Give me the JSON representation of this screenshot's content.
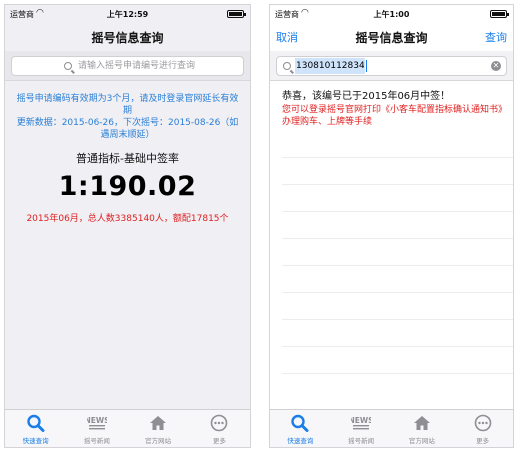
{
  "status_left": {
    "carrier": "运营商",
    "time": "上午12:59"
  },
  "status_right": {
    "carrier": "运营商",
    "time": "上午1:00"
  },
  "left_screen": {
    "title": "摇号信息查询",
    "search_placeholder": "请输入摇号申请编号进行查询",
    "info_line1": "摇号申请编码有效期为3个月，请及时登录官网延长有效期",
    "info_line2": "更新数据：2015-06-26，下次摇号：2015-08-26（如遇周末顺延）",
    "rate_label": "普通指标-基础中签率",
    "rate_value": "1:190.02",
    "rate_note": "2015年06月，总人数3385140人，额配17815个"
  },
  "right_screen": {
    "title": "摇号信息查询",
    "cancel_label": "取消",
    "query_label": "查询",
    "search_value": "1308101128349",
    "result_head": "恭喜，该编号已于2015年06月中签！",
    "result_sub": "您可以登录摇号官网打印《小客车配置指标确认通知书》办理购车、上牌等手续"
  },
  "tabs": [
    {
      "label": "快速查询",
      "icon": "search-icon",
      "active": true
    },
    {
      "label": "摇号新闻",
      "icon": "news-icon",
      "active": false
    },
    {
      "label": "官方网站",
      "icon": "home-icon",
      "active": false
    },
    {
      "label": "更多",
      "icon": "more-icon",
      "active": false
    }
  ],
  "colors": {
    "accent": "#1a7ee8",
    "alert": "#e02020",
    "info": "#2b7fd6",
    "inactive": "#8e8e93"
  }
}
